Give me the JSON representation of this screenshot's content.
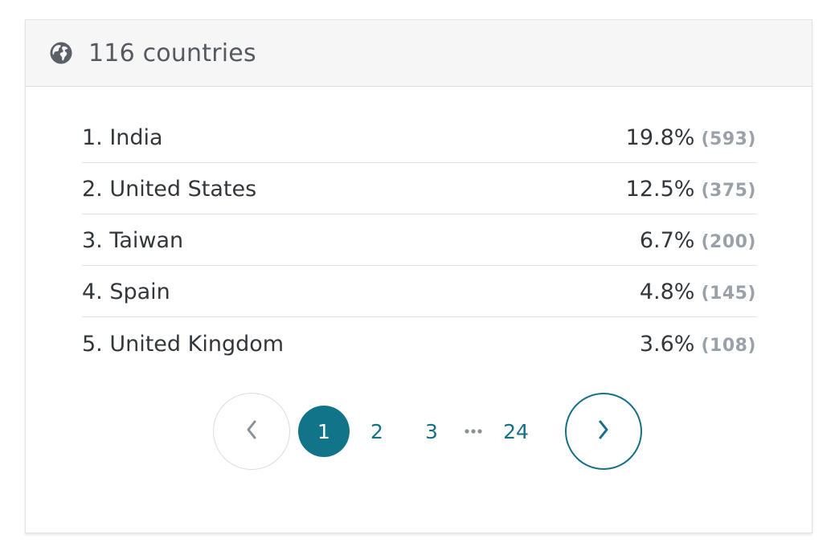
{
  "header": {
    "icon": "globe-icon",
    "title": "116 countries"
  },
  "rows": [
    {
      "label": "1. India",
      "percent": "19.8%",
      "count": "(593)"
    },
    {
      "label": "2. United States",
      "percent": "12.5%",
      "count": "(375)"
    },
    {
      "label": "3. Taiwan",
      "percent": "6.7%",
      "count": "(200)"
    },
    {
      "label": "4. Spain",
      "percent": "4.8%",
      "count": "(145)"
    },
    {
      "label": "5. United Kingdom",
      "percent": "3.6%",
      "count": "(108)"
    }
  ],
  "pagination": {
    "prev_icon": "chevron-left-icon",
    "next_icon": "chevron-right-icon",
    "pages": [
      "1",
      "2",
      "3",
      "24"
    ],
    "current": "1",
    "ellipsis_icon": "ellipsis-icon"
  },
  "colors": {
    "accent": "#127489",
    "muted": "#9aa1a8",
    "text": "#33373c"
  }
}
